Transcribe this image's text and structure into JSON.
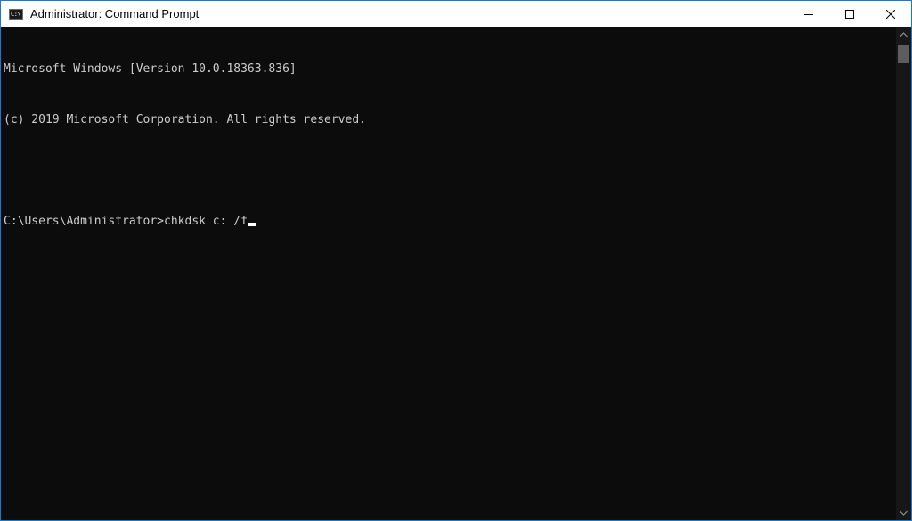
{
  "window": {
    "title": "Administrator: Command Prompt",
    "app_icon_glyph": "C:\\",
    "accent_color": "#1979ca",
    "console_background": "#0c0c0c",
    "console_foreground": "#cccccc"
  },
  "caption_buttons": {
    "minimize_icon": "minimize-icon",
    "maximize_icon": "maximize-icon",
    "close_icon": "close-icon"
  },
  "console": {
    "lines": [
      "Microsoft Windows [Version 10.0.18363.836]",
      "(c) 2019 Microsoft Corporation. All rights reserved.",
      "",
      "C:\\Users\\Administrator>chkdsk c: /f"
    ],
    "cursor_visible": true
  },
  "scrollbar": {
    "up_icon": "chevron-up-icon",
    "down_icon": "chevron-down-icon"
  }
}
